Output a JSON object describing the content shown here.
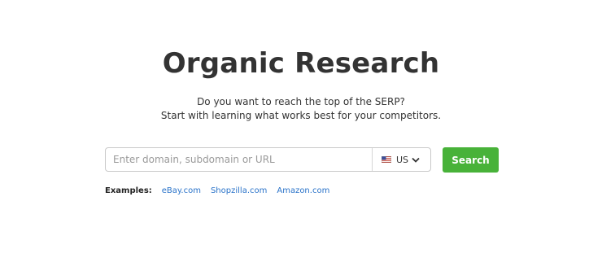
{
  "header": {
    "title": "Organic Research",
    "subtitle_line1": "Do you want to reach the top of the SERP?",
    "subtitle_line2": "Start with learning what works best for your competitors."
  },
  "search": {
    "placeholder": "Enter domain, subdomain or URL",
    "value": "",
    "database": {
      "selected": "US",
      "flag_icon": "us-flag-icon",
      "arrow_icon": "chevron-down-icon"
    },
    "button_label": "Search"
  },
  "examples": {
    "label": "Examples:",
    "links": [
      "eBay.com",
      "Shopzilla.com",
      "Amazon.com"
    ]
  },
  "colors": {
    "accent": "#48b239",
    "link": "#2a73c9",
    "text": "#333333"
  }
}
